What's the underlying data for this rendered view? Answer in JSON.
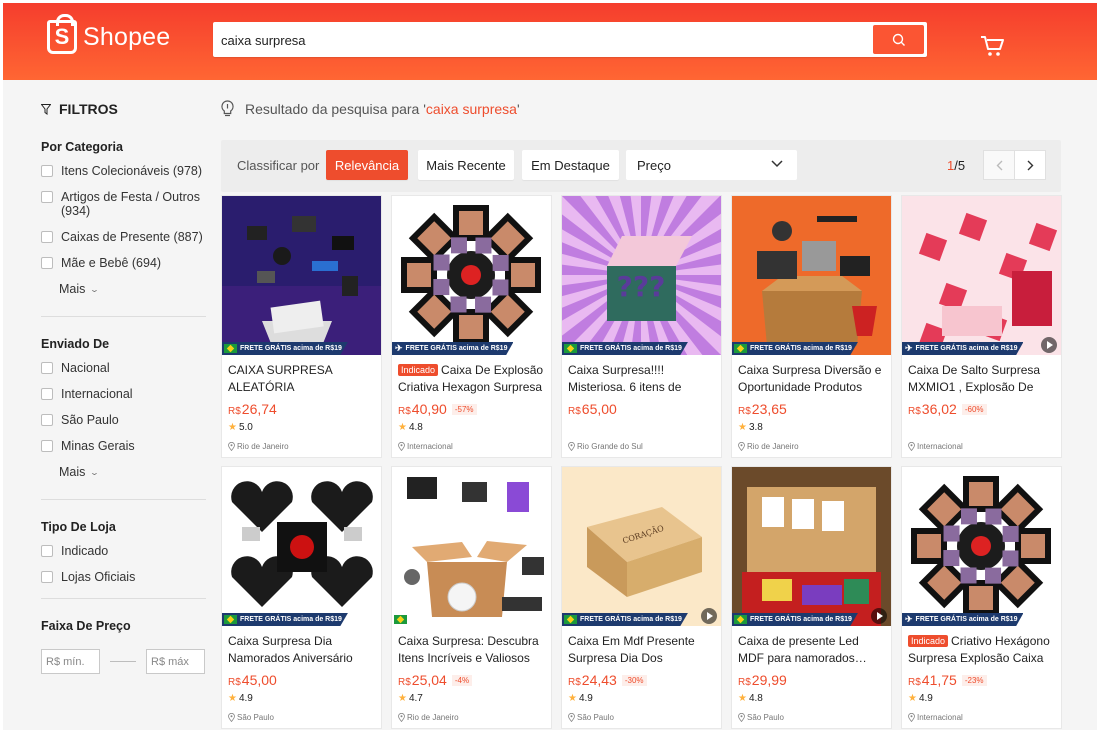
{
  "header": {
    "logo_text": "Shopee",
    "search_value": "caixa surpresa",
    "search_placeholder": ""
  },
  "sidebar": {
    "title": "FILTROS",
    "category": {
      "title": "Por Categoria",
      "items": [
        "Itens Colecionáveis (978)",
        "Artigos de Festa / Outros (934)",
        "Caixas de Presente (887)",
        "Mãe e Bebê (694)"
      ],
      "more": "Mais"
    },
    "shipping": {
      "title": "Enviado De",
      "items": [
        "Nacional",
        "Internacional",
        "São Paulo",
        "Minas Gerais"
      ],
      "more": "Mais"
    },
    "store": {
      "title": "Tipo De Loja",
      "items": [
        "Indicado",
        "Lojas Oficiais"
      ]
    },
    "price": {
      "title": "Faixa De Preço",
      "min_placeholder": "R$ mín.",
      "max_placeholder": "R$ máx"
    }
  },
  "results": {
    "prefix": "Resultado da pesquisa para '",
    "query": "caixa surpresa",
    "suffix": "'"
  },
  "sort": {
    "label": "Classificar por",
    "options": [
      "Relevância",
      "Mais Recente",
      "Em Destaque"
    ],
    "active": "Relevância",
    "price_label": "Preço",
    "page_current": "1",
    "page_total": "/5"
  },
  "labels": {
    "free_shipping": "FRETE GRÁTIS acima de R$19",
    "indicated_badge": "Indicado",
    "currency": "R$"
  },
  "products": [
    {
      "name": "CAIXA SURPRESA ALEATÓRIA",
      "price": "26,74",
      "discount": "",
      "rating": "5.0",
      "location": "Rio de Janeiro",
      "badge": false,
      "shipping": "flag",
      "video": false,
      "art": "tech"
    },
    {
      "name": "Caixa De Explosão Criativa Hexagon Surpresa",
      "price": "40,90",
      "discount": "-57%",
      "rating": "4.8",
      "location": "Internacional",
      "badge": true,
      "shipping": "plane",
      "video": false,
      "art": "hex"
    },
    {
      "name": "Caixa Surpresa!!!! Misteriosa. 6 itens de",
      "price": "65,00",
      "discount": "",
      "rating": "",
      "location": "Rio Grande do Sul",
      "badge": false,
      "shipping": "flag",
      "video": false,
      "art": "mystery"
    },
    {
      "name": "Caixa Surpresa Diversão e Oportunidade Produtos",
      "price": "23,65",
      "discount": "",
      "rating": "3.8",
      "location": "Rio de Janeiro",
      "badge": false,
      "shipping": "flag",
      "video": false,
      "art": "gadgets"
    },
    {
      "name": "Caixa De Salto Surpresa MXMIO1 , Explosão De",
      "price": "36,02",
      "discount": "-60%",
      "rating": "",
      "location": "Internacional",
      "badge": false,
      "shipping": "plane",
      "video": true,
      "art": "pink"
    },
    {
      "name": "Caixa Surpresa Dia Namorados Aniversário",
      "price": "45,00",
      "discount": "",
      "rating": "4.9",
      "location": "São Paulo",
      "badge": false,
      "shipping": "flag",
      "video": false,
      "art": "hearts"
    },
    {
      "name": "Caixa Surpresa: Descubra Itens Incríveis e Valiosos",
      "price": "25,04",
      "discount": "-4%",
      "rating": "4.7",
      "location": "Rio de Janeiro",
      "badge": false,
      "shipping": "flagonly",
      "video": false,
      "art": "box"
    },
    {
      "name": "Caixa Em Mdf Presente Surpresa Dia Dos",
      "price": "24,43",
      "discount": "-30%",
      "rating": "4.9",
      "location": "São Paulo",
      "badge": false,
      "shipping": "flag",
      "video": true,
      "art": "wood"
    },
    {
      "name": "Caixa de presente Led MDF para namorados namorada",
      "price": "29,99",
      "discount": "",
      "rating": "4.8",
      "location": "São Paulo",
      "badge": false,
      "shipping": "flag",
      "video": true,
      "art": "led"
    },
    {
      "name": "Criativo Hexágono Surpresa Explosão Caixa",
      "price": "41,75",
      "discount": "-23%",
      "rating": "4.9",
      "location": "Internacional",
      "badge": true,
      "shipping": "plane",
      "video": false,
      "art": "hex2"
    }
  ],
  "colors": {
    "brand": "#ee4d2d",
    "header_top": "#f53d2d",
    "header_bottom": "#ff6633"
  },
  "icons": [
    "shopee-bag-icon",
    "search-icon",
    "cart-icon",
    "filter-icon",
    "lightbulb-icon",
    "chevron-down-icon",
    "chevron-left-icon",
    "chevron-right-icon",
    "star-icon",
    "location-pin-icon",
    "play-icon",
    "plane-icon",
    "brazil-flag-icon"
  ]
}
